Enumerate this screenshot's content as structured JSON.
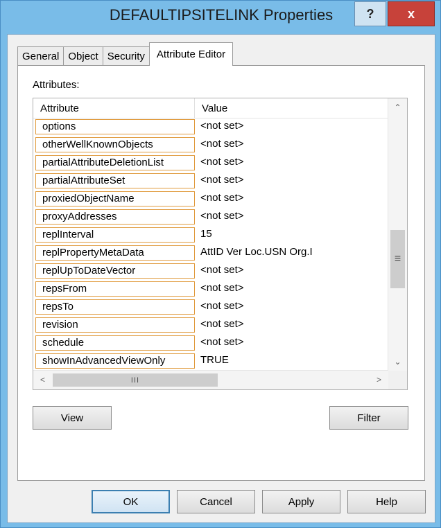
{
  "window": {
    "title": "DEFAULTIPSITELINK Properties",
    "help_label": "?",
    "close_label": "x"
  },
  "tabs": [
    {
      "label": "General",
      "active": false
    },
    {
      "label": "Object",
      "active": false
    },
    {
      "label": "Security",
      "active": false
    },
    {
      "label": "Attribute Editor",
      "active": true
    }
  ],
  "attributes_label": "Attributes:",
  "table": {
    "columns": [
      "Attribute",
      "Value"
    ],
    "rows": [
      {
        "attribute": "options",
        "value": "<not set>"
      },
      {
        "attribute": "otherWellKnownObjects",
        "value": "<not set>"
      },
      {
        "attribute": "partialAttributeDeletionList",
        "value": "<not set>"
      },
      {
        "attribute": "partialAttributeSet",
        "value": "<not set>"
      },
      {
        "attribute": "proxiedObjectName",
        "value": "<not set>"
      },
      {
        "attribute": "proxyAddresses",
        "value": "<not set>"
      },
      {
        "attribute": "replInterval",
        "value": "15"
      },
      {
        "attribute": "replPropertyMetaData",
        "value": " AttID  Ver    Loc.USN                    Org.I"
      },
      {
        "attribute": "replUpToDateVector",
        "value": "<not set>"
      },
      {
        "attribute": "repsFrom",
        "value": "<not set>"
      },
      {
        "attribute": "repsTo",
        "value": "<not set>"
      },
      {
        "attribute": "revision",
        "value": "<not set>"
      },
      {
        "attribute": "schedule",
        "value": "<not set>"
      },
      {
        "attribute": "showInAdvancedViewOnly",
        "value": "TRUE"
      }
    ]
  },
  "scrollbar": {
    "up": "⌃",
    "down": "⌄",
    "left": "<",
    "right": ">",
    "vthumb_grip": "≡",
    "hthumb_grip": "III"
  },
  "buttons": {
    "view": "View",
    "filter": "Filter",
    "ok": "OK",
    "cancel": "Cancel",
    "apply": "Apply",
    "help": "Help"
  }
}
